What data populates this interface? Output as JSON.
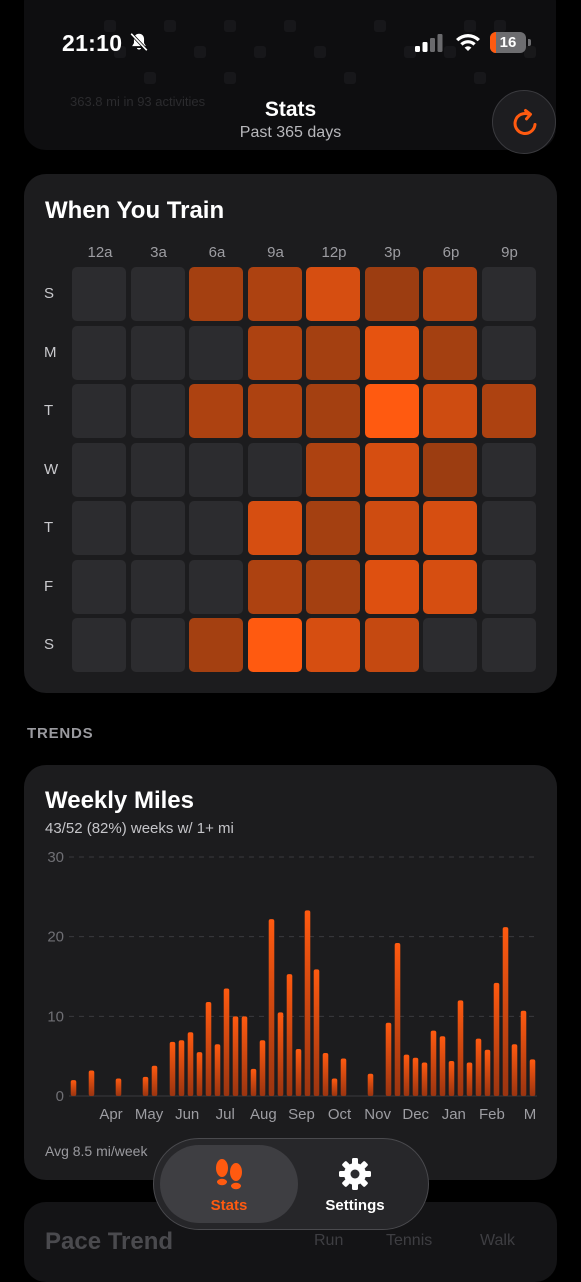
{
  "status_bar": {
    "time": "21:10",
    "battery": "16",
    "battery_level": 0.16
  },
  "header": {
    "title": "Stats",
    "subtitle": "Past 365 days",
    "refresh_icon": "refresh-icon"
  },
  "background_card": {
    "caption": "363.8 mi in 93 activities"
  },
  "heatmap_card": {
    "title": "When You Train",
    "hours": [
      "12a",
      "3a",
      "6a",
      "9a",
      "12p",
      "3p",
      "6p",
      "9p"
    ],
    "days": [
      "S",
      "M",
      "T",
      "W",
      "T",
      "F",
      "S"
    ],
    "intensity": [
      [
        0,
        0,
        0.45,
        0.5,
        0.75,
        0.4,
        0.5,
        0
      ],
      [
        0,
        0,
        0,
        0.5,
        0.45,
        0.85,
        0.45,
        0
      ],
      [
        0,
        0,
        0.5,
        0.5,
        0.45,
        1.0,
        0.7,
        0.5
      ],
      [
        0,
        0,
        0,
        0,
        0.5,
        0.75,
        0.4,
        0
      ],
      [
        0,
        0,
        0,
        0.75,
        0.45,
        0.7,
        0.75,
        0
      ],
      [
        0,
        0,
        0,
        0.5,
        0.45,
        0.8,
        0.75,
        0
      ],
      [
        0,
        0,
        0.45,
        1.0,
        0.75,
        0.65,
        0,
        0
      ]
    ],
    "colors": {
      "empty": "#2c2c2f",
      "low": "#5a2a12",
      "high": "#ff5a10"
    }
  },
  "section_trends": {
    "label": "TRENDS"
  },
  "weekly_miles": {
    "title": "Weekly Miles",
    "subtitle": "43/52 (82%) weeks w/ 1+ mi",
    "avg_text": "Avg 8.5 mi/week"
  },
  "chart_data": {
    "type": "bar",
    "title": "Weekly Miles",
    "ylim": [
      0,
      30
    ],
    "yticks": [
      0,
      10,
      20,
      30
    ],
    "month_labels": [
      "Apr",
      "May",
      "Jun",
      "Jul",
      "Aug",
      "Sep",
      "Oct",
      "Nov",
      "Dec",
      "Jan",
      "Feb",
      "M"
    ],
    "values": [
      2,
      0,
      3.2,
      0,
      0,
      2.2,
      0,
      0,
      2.4,
      3.8,
      0,
      6.8,
      7,
      8,
      5.5,
      11.8,
      6.5,
      13.5,
      10,
      10,
      3.4,
      7,
      22.2,
      10.5,
      15.3,
      5.9,
      23.3,
      15.9,
      5.4,
      2.2,
      4.7,
      0,
      0,
      2.8,
      0,
      9.2,
      19.2,
      5.2,
      4.8,
      4.2,
      8.2,
      7.5,
      4.4,
      12,
      4.2,
      7.2,
      5.8,
      14.2,
      21.2,
      6.5,
      10.7,
      4.6
    ],
    "grid": "dashed horizontal",
    "color": "#ff5a10"
  },
  "pace_card": {
    "title": "Pace Trend",
    "tabs": [
      "Run",
      "Tennis",
      "Walk"
    ]
  },
  "tab_bar": {
    "items": [
      {
        "label": "Stats",
        "icon": "footprints-icon",
        "active": true
      },
      {
        "label": "Settings",
        "icon": "gear-icon",
        "active": false
      }
    ]
  }
}
